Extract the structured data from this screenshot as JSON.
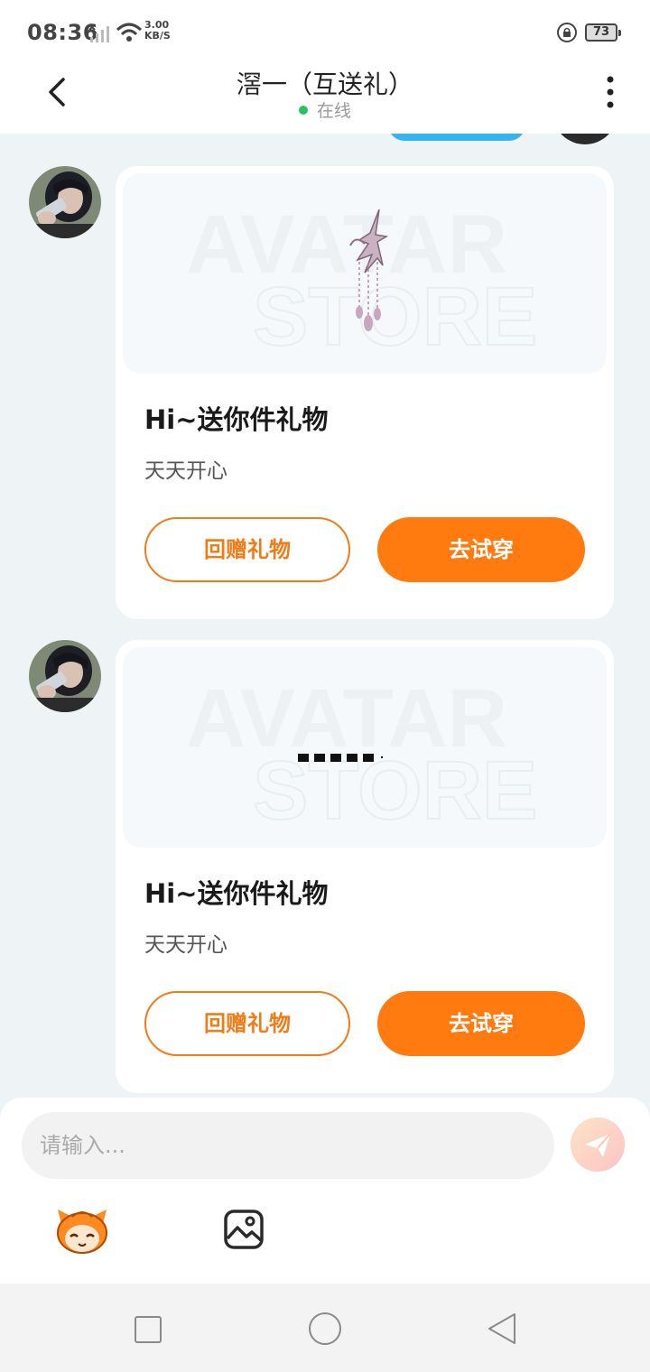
{
  "status_bar": {
    "time": "08:36",
    "net_speed_value": "3.00",
    "net_speed_unit": "KB/S",
    "battery": "73"
  },
  "header": {
    "title": "滘一（互送礼）",
    "status": "在线",
    "status_color": "#22c55e"
  },
  "messages": [
    {
      "preview_watermark_1": "AVATAR",
      "preview_watermark_2": "STORE",
      "title": "Hi~送你件礼物",
      "message": "天天开心",
      "return_gift_label": "回赠礼物",
      "try_on_label": "去试穿"
    },
    {
      "preview_watermark_1": "AVATAR",
      "preview_watermark_2": "STORE",
      "title": "Hi~送你件礼物",
      "message": "天天开心",
      "return_gift_label": "回赠礼物",
      "try_on_label": "去试穿"
    }
  ],
  "input": {
    "placeholder": "请输入..."
  },
  "colors": {
    "accent": "#ff7a0f",
    "background": "#eef3f6",
    "card": "#ffffff"
  },
  "icons": [
    "back-arrow-icon",
    "more-vertical-icon",
    "send-icon",
    "emoji-mascot-icon",
    "image-gallery-icon"
  ]
}
